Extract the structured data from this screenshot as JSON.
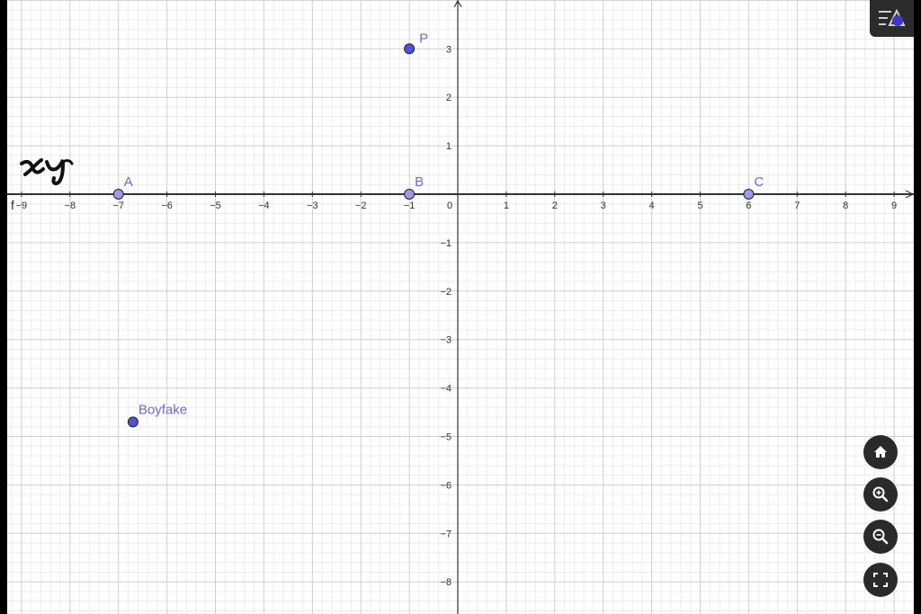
{
  "graph": {
    "x_range": [
      -9,
      9
    ],
    "y_range": [
      -8,
      3
    ],
    "x_ticks": [
      "−9",
      "−8",
      "−7",
      "−6",
      "−5",
      "−4",
      "−3",
      "−2",
      "−1",
      "0",
      "1",
      "2",
      "3",
      "4",
      "5",
      "6",
      "7",
      "8",
      "9"
    ],
    "y_ticks_positive": [
      "1",
      "2",
      "3"
    ],
    "y_ticks_negative": [
      "−1",
      "−2",
      "−3",
      "−4",
      "−5",
      "−6",
      "−7",
      "−8"
    ],
    "line_label": "f",
    "handwritten_label": "xy",
    "points": [
      {
        "name": "P",
        "x": -1,
        "y": 3,
        "style": "filled"
      },
      {
        "name": "A",
        "x": -7,
        "y": 0,
        "style": "light"
      },
      {
        "name": "B",
        "x": -1,
        "y": 0,
        "style": "light"
      },
      {
        "name": "C",
        "x": 6,
        "y": 0,
        "style": "light"
      },
      {
        "name": "Boyfake",
        "x": -6.7,
        "y": -4.7,
        "style": "filled"
      }
    ],
    "colors": {
      "point_fill": "#5050d8",
      "point_fill_light": "#9a9ae8",
      "label": "#6a6ad8",
      "axis": "#333333",
      "grid_major": "#cfcfcf",
      "grid_minor": "#ececec"
    }
  },
  "toolbar": {
    "menu_icon": "graphics-style-icon",
    "nav_buttons": [
      {
        "name": "home-button",
        "icon": "home-icon"
      },
      {
        "name": "zoom-in-button",
        "icon": "zoom-in-icon"
      },
      {
        "name": "zoom-out-button",
        "icon": "zoom-out-icon"
      },
      {
        "name": "fullscreen-button",
        "icon": "fullscreen-icon"
      }
    ]
  }
}
